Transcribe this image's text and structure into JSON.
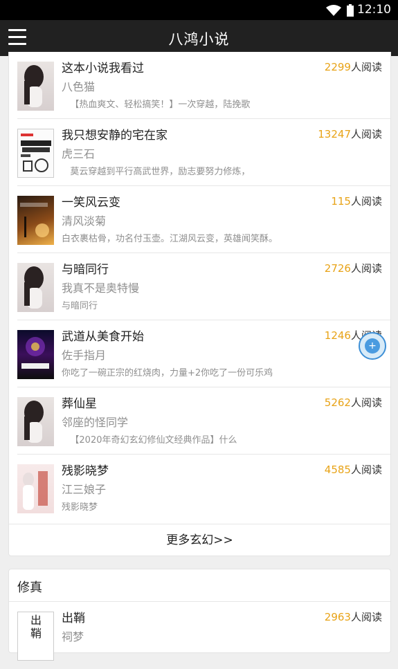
{
  "status_bar": {
    "time": "12:10"
  },
  "app_bar": {
    "title": "八鸿小说"
  },
  "books": [
    {
      "title": "这本小说我看过",
      "author": "八色猫",
      "desc": "   【热血爽文、轻松搞笑！】一次穿越，陆挽歌",
      "reads": "2299",
      "reads_suffix": "人阅读"
    },
    {
      "title": "我只想安静的宅在家",
      "author": "虎三石",
      "desc": "   莫云穿越到平行高武世界，励志要努力修炼，",
      "reads": "13247",
      "reads_suffix": "人阅读"
    },
    {
      "title": "一笑风云变",
      "author": "清风淡菊",
      "desc": "白衣裹枯骨，功名付玉壶。江湖风云变，英雄闻笑酥。",
      "reads": "115",
      "reads_suffix": "人阅读"
    },
    {
      "title": "与暗同行",
      "author": "我真不是奥特慢",
      "desc": "与暗同行",
      "reads": "2726",
      "reads_suffix": "人阅读"
    },
    {
      "title": "武道从美食开始",
      "author": "佐手指月",
      "desc": "你吃了一碗正宗的红烧肉，力量+2你吃了一份可乐鸡",
      "reads": "1246",
      "reads_suffix": "人阅读"
    },
    {
      "title": "葬仙星",
      "author": "邻座的怪同学",
      "desc": "   【2020年奇幻玄幻修仙文经典作品】什么",
      "reads": "5262",
      "reads_suffix": "人阅读"
    },
    {
      "title": "残影晓梦",
      "author": "江三娘子",
      "desc": "残影晓梦",
      "reads": "4585",
      "reads_suffix": "人阅读"
    }
  ],
  "more_link": "更多玄幻>>",
  "section2": {
    "title": "修真",
    "books": [
      {
        "title": "出鞘",
        "author": "祠梦",
        "reads": "2963",
        "reads_suffix": "人阅读",
        "cover_alt": "出鞘"
      }
    ]
  },
  "fab": {
    "icon": "floating-action-icon",
    "color": "#4a9be0"
  },
  "colors": {
    "accent": "#e8a317",
    "app_bar": "#212121"
  }
}
